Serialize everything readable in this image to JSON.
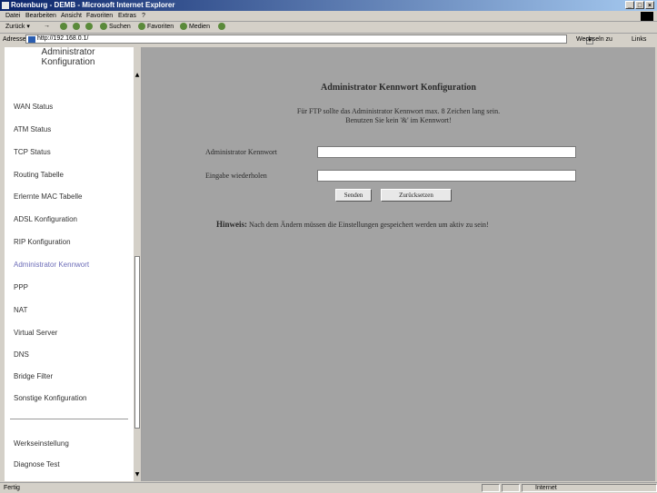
{
  "window": {
    "title": "Rotenburg - DEMB - Microsoft Internet Explorer"
  },
  "menubar": {
    "items": [
      "Datei",
      "Bearbeiten",
      "Ansicht",
      "Favoriten",
      "Extras",
      "?"
    ]
  },
  "toolbar": {
    "back": "Zurück",
    "search": "Suchen",
    "favorites": "Favoriten",
    "media": "Medien"
  },
  "addressbar": {
    "label": "Adresse",
    "url": "http://192.168.0.1/",
    "go": "Wechseln zu",
    "links": "Links"
  },
  "sidebar": {
    "header": [
      "Administrator",
      "Konfiguration"
    ],
    "items": [
      {
        "label": "WAN Status"
      },
      {
        "label": "ATM Status"
      },
      {
        "label": "TCP Status"
      },
      {
        "label": "Routing Tabelle"
      },
      {
        "label": "Erlernte MAC Tabelle"
      },
      {
        "label": "ADSL Konfiguration"
      },
      {
        "label": "RIP Konfiguration"
      },
      {
        "label": "Administrator Kennwort",
        "active": true
      },
      {
        "label": "PPP"
      },
      {
        "label": "NAT"
      },
      {
        "label": "Virtual Server"
      },
      {
        "label": "DNS"
      },
      {
        "label": "Bridge Filter"
      },
      {
        "label": "Sonstige Konfiguration"
      }
    ],
    "bottom_items": [
      {
        "label": "Werkseinstellung"
      },
      {
        "label": "Diagnose Test"
      }
    ]
  },
  "main": {
    "title": "Administrator Kennwort Konfiguration",
    "desc_line1": "Für FTP sollte das Administrator Kennwort max. 8 Zeichen lang sein.",
    "desc_line2": "Benutzen Sie kein '&' im Kennwort!",
    "password_label": "Administrator Kennwort",
    "confirm_label": "Eingabe wiederholen",
    "password_value": "",
    "confirm_value": "",
    "submit": "Senden",
    "reset": "Zurücksetzen",
    "note_label": "Hinweis:",
    "note_text": "Nach dem Ändern müssen die Einstellungen gespeichert werden um aktiv zu sein!"
  },
  "statusbar": {
    "left": "Fertig",
    "zone": "Internet"
  },
  "colors": {
    "content_bg": "#a3a3a3",
    "active_nav": "#6d6db8",
    "titlebar": "#0a246a"
  }
}
